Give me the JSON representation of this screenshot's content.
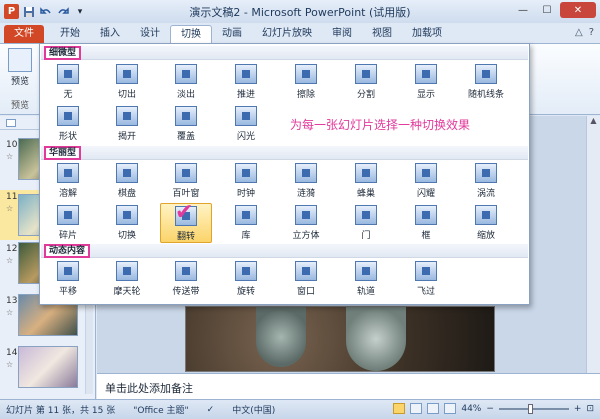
{
  "window": {
    "title": "演示文稿2 - Microsoft PowerPoint (试用版)",
    "minimize": "—",
    "maximize": "☐",
    "close": "✕"
  },
  "qat_icons": [
    "save-icon",
    "undo-icon",
    "redo-icon",
    "customize-icon"
  ],
  "tabs": [
    {
      "label": "文件"
    },
    {
      "label": "开始"
    },
    {
      "label": "插入"
    },
    {
      "label": "设计"
    },
    {
      "label": "切换"
    },
    {
      "label": "动画"
    },
    {
      "label": "幻灯片放映"
    },
    {
      "label": "审阅"
    },
    {
      "label": "视图"
    },
    {
      "label": "加载项"
    }
  ],
  "ribbon": {
    "preview_label": "预览",
    "preview_group_name": "预览"
  },
  "gallery": {
    "annotation": "为每一张幻灯片选择一种切换效果",
    "sections": [
      {
        "title": "细微型",
        "rows": [
          [
            "无",
            "切出",
            "淡出",
            "推进",
            "擦除",
            "分割",
            "显示",
            "随机线条"
          ],
          [
            "形状",
            "揭开",
            "覆盖",
            "闪光"
          ]
        ]
      },
      {
        "title": "华丽型",
        "rows": [
          [
            "溶解",
            "棋盘",
            "百叶窗",
            "时钟",
            "涟漪",
            "蜂巢",
            "闪耀",
            "涡流"
          ],
          [
            "碎片",
            "切换",
            "翻转",
            "库",
            "立方体",
            "门",
            "框",
            "缩放"
          ]
        ]
      },
      {
        "title": "动态内容",
        "rows": [
          [
            "平移",
            "摩天轮",
            "传送带",
            "旋转",
            "窗口",
            "轨道",
            "飞过"
          ]
        ]
      }
    ],
    "selected_item": "翻转"
  },
  "slides": [
    {
      "number": "10",
      "icon": "☆"
    },
    {
      "number": "11",
      "icon": "☆"
    },
    {
      "number": "12",
      "icon": "☆"
    },
    {
      "number": "13",
      "icon": "☆"
    },
    {
      "number": "14",
      "icon": "☆"
    }
  ],
  "selected_slide": "11",
  "notes": {
    "placeholder": "单击此处添加备注"
  },
  "status": {
    "slide_info": "幻灯片 第 11 张，共 15 张",
    "theme": "\"Office 主题\"",
    "language": "中文(中国)",
    "zoom": "44%",
    "zoom_fraction": 0.44
  }
}
